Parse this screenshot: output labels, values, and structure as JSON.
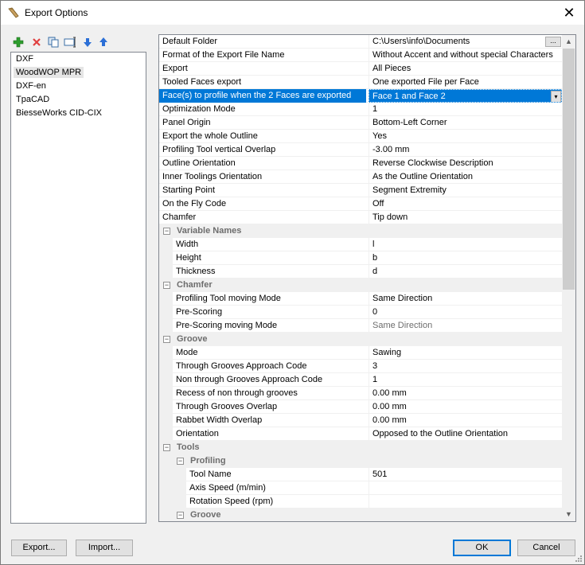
{
  "window": {
    "title": "Export Options",
    "close_glyph": "✕",
    "icon": "wood-plank-icon"
  },
  "toolbar": {
    "buttons": [
      {
        "icon": "add-icon",
        "color": "#2e9e2e"
      },
      {
        "icon": "delete-icon",
        "color": "#e04040"
      },
      {
        "icon": "copy-icon",
        "color": "#3a6ea5"
      },
      {
        "icon": "rename-icon",
        "color": "#3a6ea5"
      },
      {
        "icon": "move-down-icon",
        "color": "#2b6fd6"
      },
      {
        "icon": "move-up-icon",
        "color": "#2b6fd6"
      }
    ]
  },
  "formats": {
    "items": [
      "DXF",
      "WoodWOP MPR",
      "DXF-en",
      "TpaCAD",
      "BiesseWorks CID-CIX"
    ],
    "selected_index": 1
  },
  "properties": {
    "selected_row": 4,
    "rows": [
      {
        "type": "leaf",
        "level": 0,
        "name": "Default Folder",
        "value": "C:\\Users\\info\\Documents",
        "button": "..."
      },
      {
        "type": "leaf",
        "level": 0,
        "name": "Format of the Export File Name",
        "value": "Without Accent and without special Characters"
      },
      {
        "type": "leaf",
        "level": 0,
        "name": "Export",
        "value": "All Pieces"
      },
      {
        "type": "leaf",
        "level": 0,
        "name": "Tooled Faces export",
        "value": "One exported File per Face"
      },
      {
        "type": "leaf",
        "level": 0,
        "name": "Face(s) to profile when the 2 Faces are exported",
        "value": "Face 1 and Face 2",
        "dropdown": true
      },
      {
        "type": "leaf",
        "level": 0,
        "name": "Optimization Mode",
        "value": "1"
      },
      {
        "type": "leaf",
        "level": 0,
        "name": "Panel Origin",
        "value": "Bottom-Left Corner"
      },
      {
        "type": "leaf",
        "level": 0,
        "name": "Export the whole Outline",
        "value": "Yes"
      },
      {
        "type": "leaf",
        "level": 0,
        "name": "Profiling Tool vertical Overlap",
        "value": "-3.00 mm"
      },
      {
        "type": "leaf",
        "level": 0,
        "name": "Outline Orientation",
        "value": "Reverse Clockwise Description"
      },
      {
        "type": "leaf",
        "level": 0,
        "name": "Inner Toolings Orientation",
        "value": "As the Outline Orientation"
      },
      {
        "type": "leaf",
        "level": 0,
        "name": "Starting Point",
        "value": "Segment Extremity"
      },
      {
        "type": "leaf",
        "level": 0,
        "name": "On the Fly Code",
        "value": "Off"
      },
      {
        "type": "leaf",
        "level": 0,
        "name": "Chamfer",
        "value": "Tip down"
      },
      {
        "type": "cat",
        "level": 0,
        "name": "Variable Names",
        "toggle": "−"
      },
      {
        "type": "leaf",
        "level": 1,
        "name": "Width",
        "value": "l"
      },
      {
        "type": "leaf",
        "level": 1,
        "name": "Height",
        "value": "b"
      },
      {
        "type": "leaf",
        "level": 1,
        "name": "Thickness",
        "value": "d"
      },
      {
        "type": "cat",
        "level": 0,
        "name": "Chamfer",
        "toggle": "−"
      },
      {
        "type": "leaf",
        "level": 1,
        "name": "Profiling Tool moving Mode",
        "value": "Same Direction"
      },
      {
        "type": "leaf",
        "level": 1,
        "name": "Pre-Scoring",
        "value": "0"
      },
      {
        "type": "leaf",
        "level": 1,
        "name": "Pre-Scoring moving Mode",
        "value": "Same Direction",
        "dim": true
      },
      {
        "type": "cat",
        "level": 0,
        "name": "Groove",
        "toggle": "−"
      },
      {
        "type": "leaf",
        "level": 1,
        "name": "Mode",
        "value": "Sawing"
      },
      {
        "type": "leaf",
        "level": 1,
        "name": "Through Grooves Approach Code",
        "value": "3"
      },
      {
        "type": "leaf",
        "level": 1,
        "name": "Non through Grooves Approach Code",
        "value": "1"
      },
      {
        "type": "leaf",
        "level": 1,
        "name": "Recess of non through grooves",
        "value": "0.00 mm"
      },
      {
        "type": "leaf",
        "level": 1,
        "name": "Through Grooves Overlap",
        "value": "0.00 mm"
      },
      {
        "type": "leaf",
        "level": 1,
        "name": "Rabbet Width Overlap",
        "value": "0.00 mm"
      },
      {
        "type": "leaf",
        "level": 1,
        "name": "Orientation",
        "value": "Opposed to the Outline Orientation"
      },
      {
        "type": "cat",
        "level": 0,
        "name": "Tools",
        "toggle": "−"
      },
      {
        "type": "cat",
        "level": 1,
        "name": "Profiling",
        "toggle": "−"
      },
      {
        "type": "leaf",
        "level": 2,
        "name": "Tool Name",
        "value": "501"
      },
      {
        "type": "leaf",
        "level": 2,
        "name": "Axis Speed (m/min)",
        "value": ""
      },
      {
        "type": "leaf",
        "level": 2,
        "name": "Rotation Speed (rpm)",
        "value": ""
      },
      {
        "type": "cat",
        "level": 1,
        "name": "Groove",
        "toggle": "−"
      }
    ]
  },
  "scrollbar": {
    "up_glyph": "▲",
    "down_glyph": "▼"
  },
  "buttons": {
    "export_label": "Export...",
    "import_label": "Import...",
    "ok_label": "OK",
    "cancel_label": "Cancel"
  },
  "colors": {
    "selection": "#0078d7",
    "category_bg": "#f0f0f0"
  }
}
